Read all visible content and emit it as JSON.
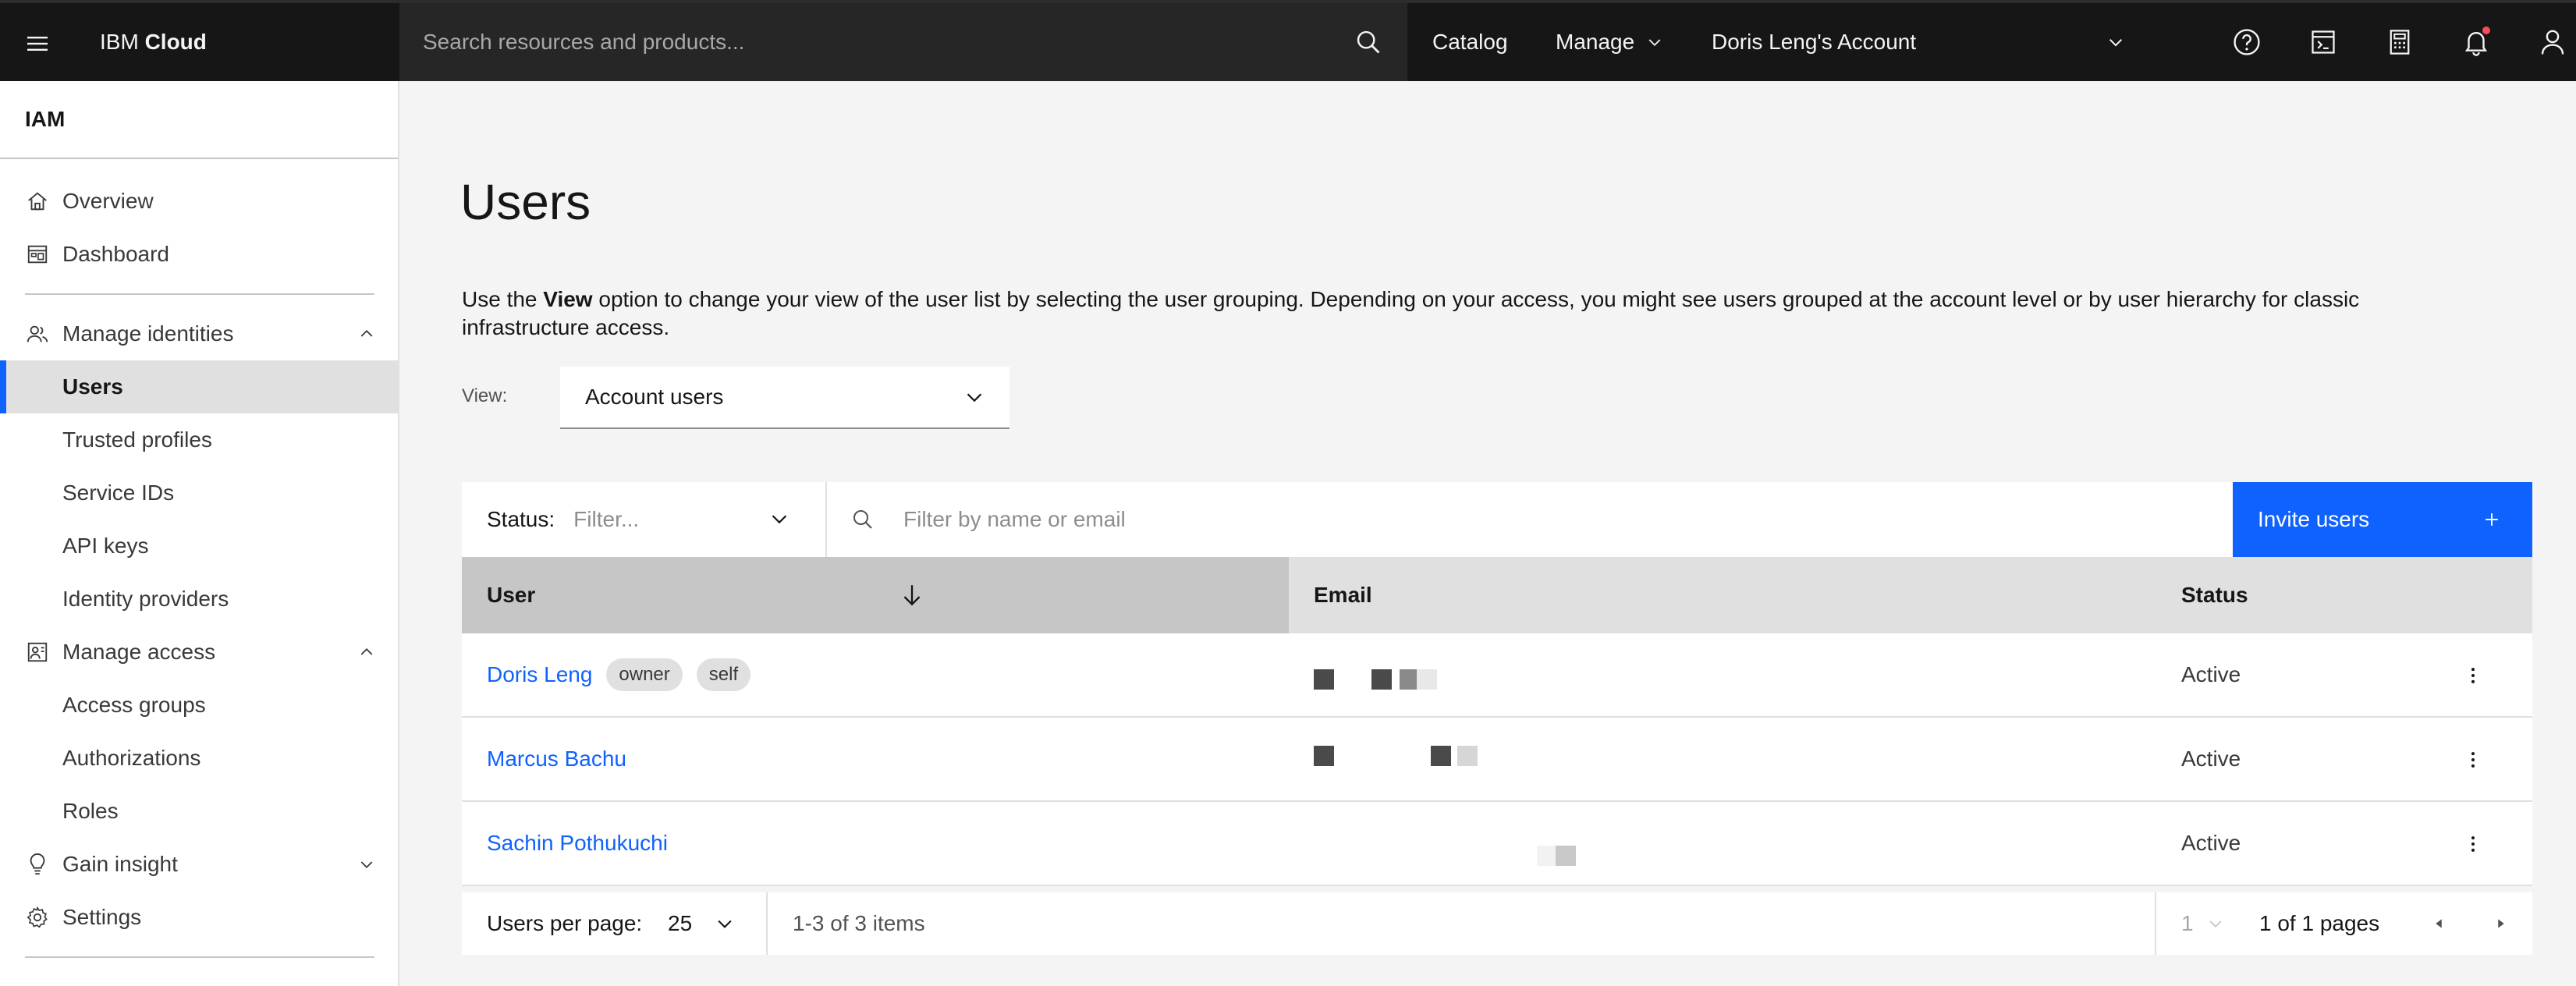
{
  "header": {
    "brand_prefix": "IBM",
    "brand_name": "Cloud",
    "search_placeholder": "Search resources and products...",
    "nav": {
      "catalog": "Catalog",
      "manage": "Manage",
      "account": "Doris Leng's Account"
    },
    "icons": [
      "hamburger-icon",
      "search-icon",
      "help-icon",
      "cost-estimator-icon",
      "calculator-icon",
      "notification-icon",
      "user-avatar-icon"
    ],
    "notification_color": "#fa4d56"
  },
  "sidebar": {
    "title": "IAM",
    "items": [
      {
        "label": "Overview",
        "icon": "home-icon"
      },
      {
        "label": "Dashboard",
        "icon": "dashboard-icon"
      },
      {
        "label": "Manage identities",
        "icon": "user-group-icon",
        "expanded": true
      },
      {
        "label": "Users",
        "active": true
      },
      {
        "label": "Trusted profiles"
      },
      {
        "label": "Service IDs"
      },
      {
        "label": "API keys"
      },
      {
        "label": "Identity providers"
      },
      {
        "label": "Manage access",
        "icon": "access-icon",
        "expanded": true
      },
      {
        "label": "Access groups"
      },
      {
        "label": "Authorizations"
      },
      {
        "label": "Roles"
      },
      {
        "label": "Gain insight",
        "icon": "bulb-icon",
        "expanded": false
      },
      {
        "label": "Settings",
        "icon": "gear-icon"
      }
    ]
  },
  "main": {
    "title": "Users",
    "description_pre": "Use the ",
    "description_bold": "View",
    "description_post": " option to change your view of the user list by selecting the user grouping. Depending on your access, you might see users grouped at the account level or by user hierarchy for classic infrastructure access.",
    "view_label": "View:",
    "view_value": "Account users",
    "status_label": "Status:",
    "status_placeholder": "Filter...",
    "name_filter_placeholder": "Filter by name or email",
    "invite_label": "Invite users"
  },
  "table": {
    "headers": {
      "user": "User",
      "email": "Email",
      "status": "Status"
    },
    "rows": [
      {
        "name": "Doris Leng",
        "tags": [
          "owner",
          "self"
        ],
        "status": "Active"
      },
      {
        "name": "Marcus Bachu",
        "tags": [],
        "status": "Active"
      },
      {
        "name": "Sachin Pothukuchi",
        "tags": [],
        "status": "Active"
      }
    ]
  },
  "pagination": {
    "per_page_label": "Users per page:",
    "per_page_value": "25",
    "range": "1-3 of 3 items",
    "page_value": "1",
    "pages_text": "1 of 1 pages"
  },
  "colors": {
    "accent": "#0f62fe",
    "header_bg": "#161616",
    "page_bg": "#f4f4f4"
  }
}
